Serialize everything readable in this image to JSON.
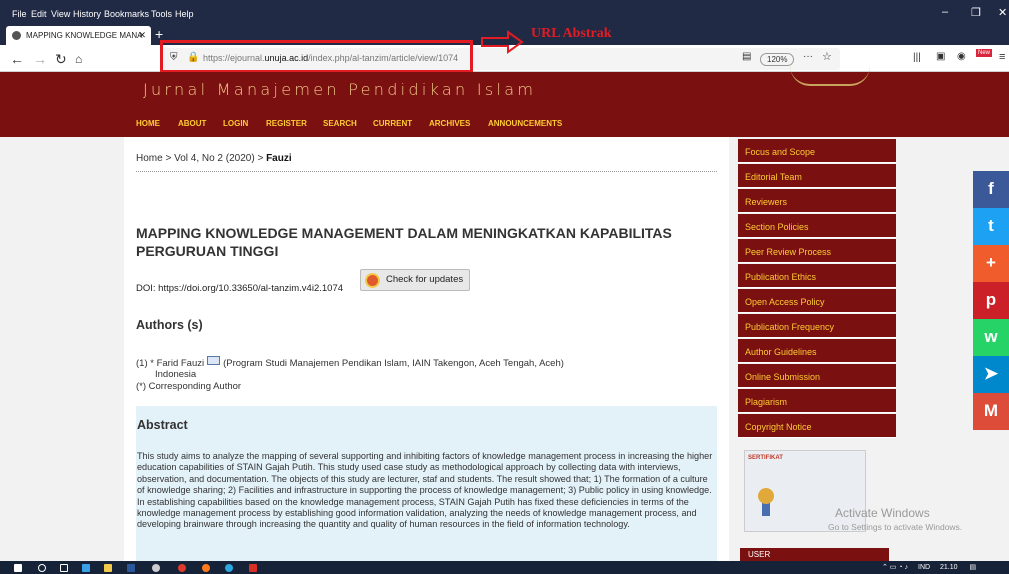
{
  "menubar": {
    "items": [
      "File",
      "Edit",
      "View",
      "History",
      "Bookmarks",
      "Tools",
      "Help"
    ]
  },
  "window_controls": {
    "minimize": "–",
    "maximize": "❐",
    "close": "✕"
  },
  "browser": {
    "tab_title": "MAPPING KNOWLEDGE MANA",
    "tab_close": "✕",
    "new_tab": "+",
    "url_prefix": "https://ejournal.",
    "url_host": "unuja.ac.id",
    "url_path": "/index.php/al-tanzim/article/view/1074",
    "zoom": "120%",
    "more": "···",
    "new_badge": "New"
  },
  "annotation": {
    "label": "URL Abstrak",
    "color": "#e31b23"
  },
  "site": {
    "journal_title": "Jurnal Manajemen Pendidikan Islam",
    "nav": [
      "HOME",
      "ABOUT",
      "LOGIN",
      "REGISTER",
      "SEARCH",
      "CURRENT",
      "ARCHIVES",
      "ANNOUNCEMENTS"
    ],
    "brand_color": "#7a1010",
    "nav_color": "#ffcc33"
  },
  "article": {
    "breadcrumb": "Home > Vol 4, No 2 (2020) > ",
    "breadcrumb_current": "Fauzi",
    "title": "MAPPING KNOWLEDGE MANAGEMENT DALAM MENINGKATKAN KAPABILITAS PERGURUAN TINGGI",
    "doi": "DOI: https://doi.org/10.33650/al-tanzim.v4i2.1074",
    "check_updates": "Check for updates",
    "authors_heading": "Authors (s)",
    "author_line": "(1) * Farid Fauzi",
    "author_affil": "(Program Studi Manajemen Pendikan Islam, IAIN Takengon, Aceh Tengah, Aceh)",
    "author_country": "Indonesia",
    "corresponding": "(*) Corresponding Author",
    "abstract_heading": "Abstract",
    "abstract_text": "This study aims to analyze the mapping of several supporting and inhibiting factors of knowledge management process in increasing the higher education capabilities of STAIN Gajah Putih. This study used case study as methodological approach by collecting data with interviews, observation, and documentation. The objects of this study are lecturer, staf and students. The result showed that; 1) The formation of a culture of knowledge sharing; 2) Facilities and infrastructure in supporting the process of knowledge management; 3) Public policy in using knowledge. In establishing capabilities based on the knowledge management process, STAIN Gajah Putih has fixed these deficiencies in terms of the knowledge management process by establishing good information validation, analyzing the needs of knowledge management process, and developing brainware through increasing the quantity and quality of human resources in the field of information technology."
  },
  "sidebar": {
    "items": [
      "Focus and Scope",
      "Editorial Team",
      "Reviewers",
      "Section Policies",
      "Peer Review Process",
      "Publication Ethics",
      "Open Access Policy",
      "Publication Frequency",
      "Author Guidelines",
      "Online Submission",
      "Plagiarism",
      "Copyright Notice"
    ],
    "certificate_label": "SERTIFIKAT",
    "user_label": "USER"
  },
  "share": {
    "icons": [
      "f",
      "t",
      "+",
      "p",
      "w",
      "➤",
      "M"
    ],
    "names": [
      "facebook-icon",
      "twitter-icon",
      "more-share-icon",
      "pinterest-icon",
      "whatsapp-icon",
      "telegram-icon",
      "gmail-icon"
    ],
    "colors": [
      "#3b5998",
      "#1da1f2",
      "#f05c2b",
      "#cb2027",
      "#25d366",
      "#0088cc",
      "#dd4b39"
    ]
  },
  "watermark": {
    "line1": "Activate Windows",
    "line2": "Go to Settings to activate Windows."
  },
  "taskbar": {
    "tray_lang": "IND",
    "time": "21.10"
  }
}
